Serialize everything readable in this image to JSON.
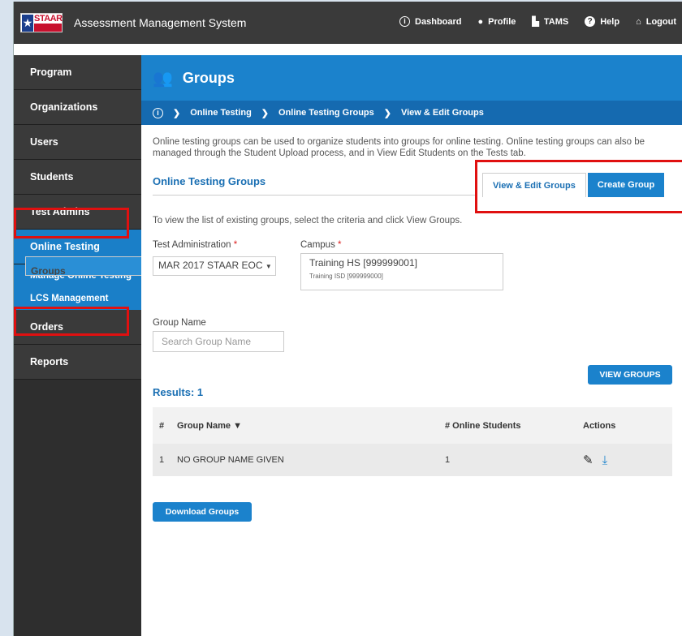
{
  "app": {
    "title": "Assessment Management System",
    "logo_text": "STAAR"
  },
  "topnav": [
    {
      "label": "Dashboard",
      "icon": "info-circle-icon"
    },
    {
      "label": "Profile",
      "icon": "person-icon"
    },
    {
      "label": "TAMS",
      "icon": "texas-icon"
    },
    {
      "label": "Help",
      "icon": "question-icon"
    },
    {
      "label": "Logout",
      "icon": "home-exit-icon"
    }
  ],
  "sidebar": {
    "program": "Program",
    "organizations": "Organizations",
    "users": "Users",
    "students": "Students",
    "test_admins": "Test Admins",
    "online_testing": "Online Testing",
    "manage_online_testing": "Manage Online Testing",
    "lcs_management": "LCS Management",
    "groups": "Groups",
    "orders": "Orders",
    "reports": "Reports"
  },
  "header": {
    "title": "Groups"
  },
  "breadcrumb": [
    "Online Testing",
    "Online Testing Groups",
    "View & Edit Groups"
  ],
  "intro": "Online testing groups can be used to organize students into groups for online testing. Online testing groups can also be managed through the Student Upload process, and in View Edit Students on the Tests tab.",
  "section_title": "Online Testing Groups",
  "tabs": {
    "view_edit": "View & Edit Groups",
    "create": "Create Group"
  },
  "hint": "To view the list of existing groups, select the criteria and click View Groups.",
  "form": {
    "test_admin_label": "Test Administration",
    "test_admin_value": "MAR 2017 STAAR EOC",
    "campus_label": "Campus",
    "campus_value": "Training HS [999999001]",
    "campus_district": "Training ISD [999999000]",
    "group_name_label": "Group Name",
    "group_name_placeholder": "Search Group Name",
    "required_mark": "*"
  },
  "view_groups_button": "VIEW GROUPS",
  "results_label": "Results: 1",
  "table": {
    "headers": {
      "num": "#",
      "name": "Group Name",
      "students": "# Online Students",
      "actions": "Actions"
    },
    "rows": [
      {
        "num": "1",
        "name": "NO GROUP NAME GIVEN",
        "students": "1"
      }
    ]
  },
  "download_button": "Download Groups",
  "colors": {
    "accent": "#1b82cc",
    "highlight": "#e01010"
  }
}
